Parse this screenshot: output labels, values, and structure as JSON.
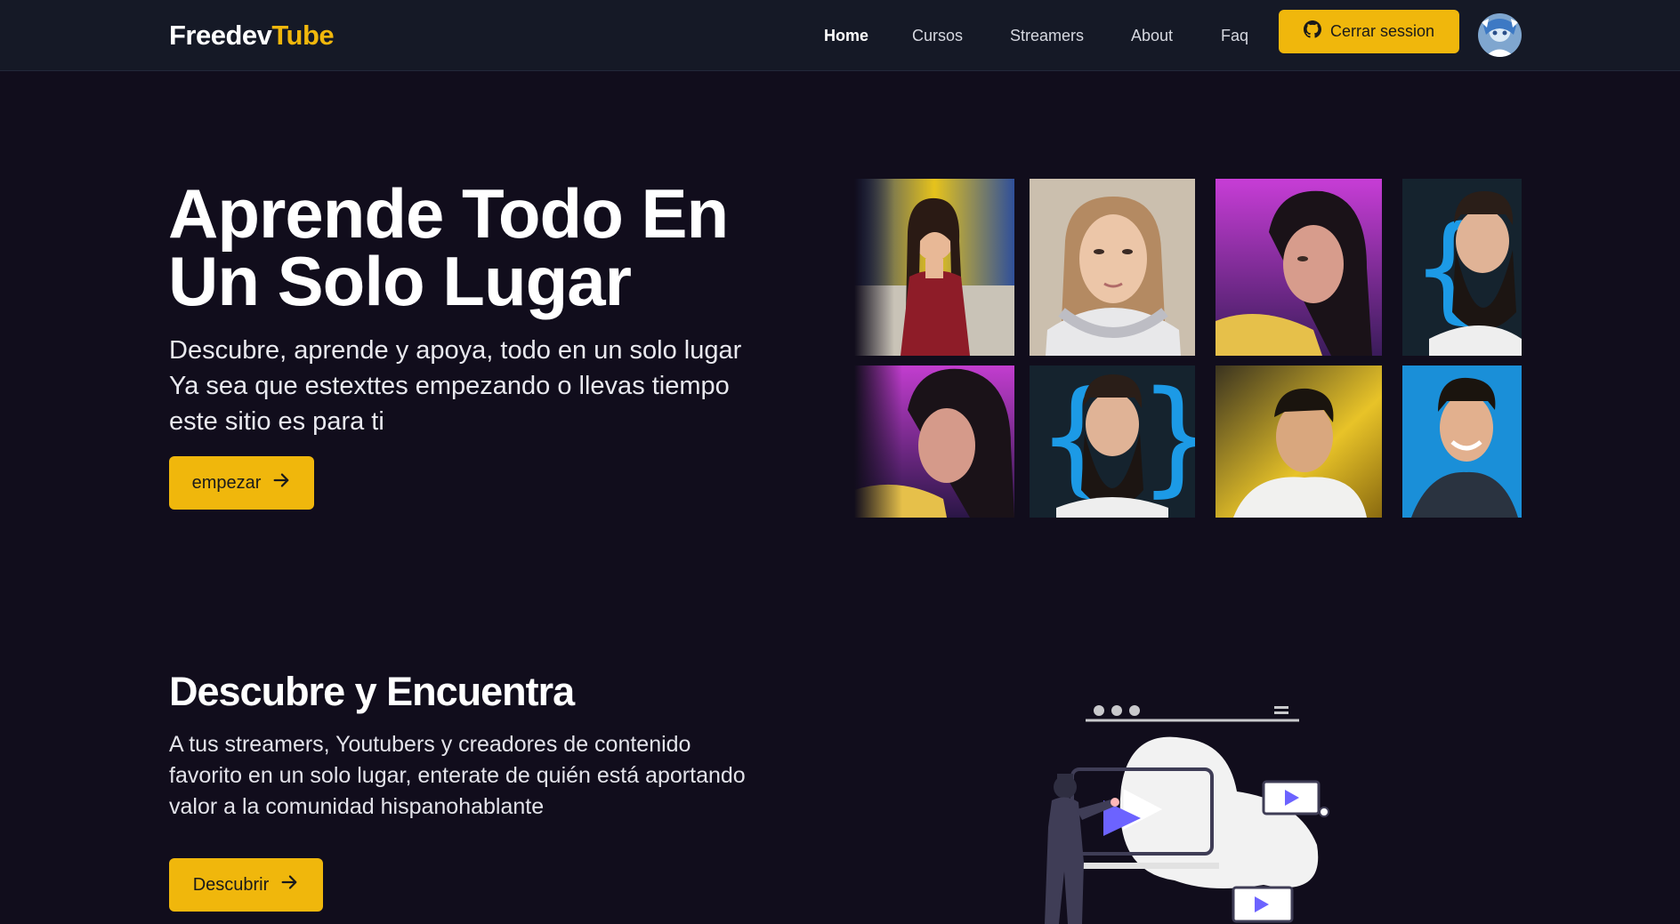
{
  "navbar": {
    "brand_part1": "Freedev",
    "brand_part2": "Tube",
    "links": [
      {
        "label": "Home",
        "active": true
      },
      {
        "label": "Cursos",
        "active": false
      },
      {
        "label": "Streamers",
        "active": false
      },
      {
        "label": "About",
        "active": false
      },
      {
        "label": "Faq",
        "active": false
      }
    ],
    "logout_label": "Cerrar session",
    "logout_icon": "github-icon",
    "avatar_icon": "user-avatar"
  },
  "hero": {
    "title_line1": "Aprende Todo En",
    "title_line2": "Un Solo Lugar",
    "subtitle_lines": [
      "Descubre, aprende y apoya, todo en un solo lugar",
      "Ya sea que estexttes empezando o llevas tiempo",
      "este sitio es para ti"
    ],
    "cta_label": "empezar",
    "cta_icon": "arrow-right-icon"
  },
  "discover": {
    "title": "Descubre y Encuentra",
    "text_lines": [
      "A tus streamers, Youtubers y creadores de contenido",
      "favorito en un solo lugar, enterate de quién está aportando",
      "valor a la comunidad hispanohablante"
    ],
    "cta_label": "Descubrir",
    "cta_icon": "arrow-right-icon"
  },
  "colors": {
    "accent": "#f0b70c",
    "background": "#110d1c",
    "navbar": "#151926",
    "illustration_accent": "#6c63ff"
  }
}
